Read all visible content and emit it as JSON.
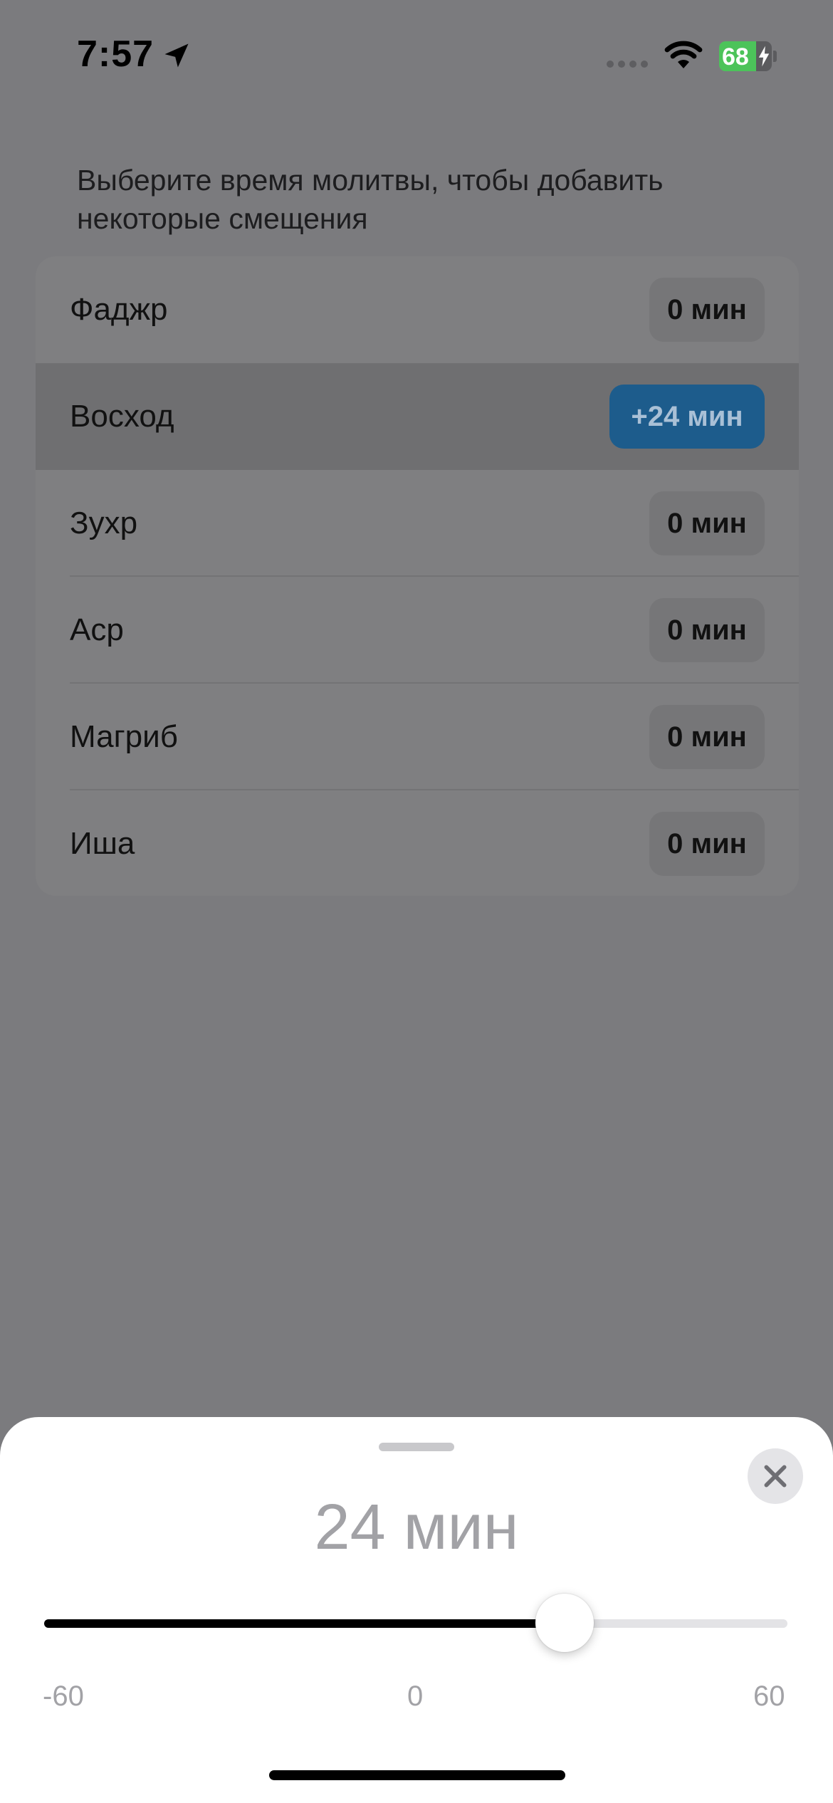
{
  "status_bar": {
    "time": "7:57",
    "battery": "68"
  },
  "intro_text": "Выберите время молитвы, чтобы добавить некоторые смещения",
  "prayers": [
    {
      "name": "Фаджр",
      "offset": "0 мин",
      "selected": false
    },
    {
      "name": "Восход",
      "offset": "+24 мин",
      "selected": true
    },
    {
      "name": "Зухр",
      "offset": "0 мин",
      "selected": false
    },
    {
      "name": "Аср",
      "offset": "0 мин",
      "selected": false
    },
    {
      "name": "Магриб",
      "offset": "0 мин",
      "selected": false
    },
    {
      "name": "Иша",
      "offset": "0 мин",
      "selected": false
    }
  ],
  "sheet": {
    "value_label": "24 мин",
    "slider": {
      "min": -60,
      "max": 60,
      "value": 24
    },
    "tick_min": "-60",
    "tick_mid": "0",
    "tick_max": "60"
  },
  "colors": {
    "accent": "#1d5c8c",
    "battery": "#4cc35a"
  }
}
